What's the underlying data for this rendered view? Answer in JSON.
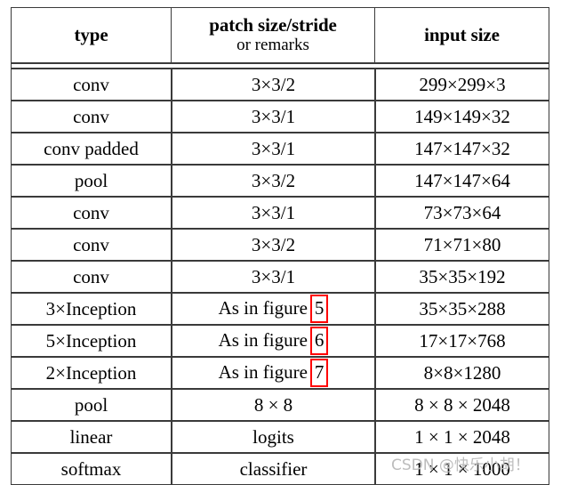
{
  "table": {
    "header": {
      "type": "type",
      "patch_main": "patch size/stride",
      "patch_sub": "or remarks",
      "input": "input size"
    },
    "rows": [
      {
        "type": "conv",
        "patch": "3×3/2",
        "fig": "",
        "input": "299×299×3"
      },
      {
        "type": "conv",
        "patch": "3×3/1",
        "fig": "",
        "input": "149×149×32"
      },
      {
        "type": "conv padded",
        "patch": "3×3/1",
        "fig": "",
        "input": "147×147×32"
      },
      {
        "type": "pool",
        "patch": "3×3/2",
        "fig": "",
        "input": "147×147×64"
      },
      {
        "type": "conv",
        "patch": "3×3/1",
        "fig": "",
        "input": "73×73×64"
      },
      {
        "type": "conv",
        "patch": "3×3/2",
        "fig": "",
        "input": "71×71×80"
      },
      {
        "type": "conv",
        "patch": "3×3/1",
        "fig": "",
        "input": "35×35×192"
      },
      {
        "type": "3×Inception",
        "patch": "As in figure",
        "fig": "5",
        "input": "35×35×288"
      },
      {
        "type": "5×Inception",
        "patch": "As in figure",
        "fig": "6",
        "input": "17×17×768"
      },
      {
        "type": "2×Inception",
        "patch": "As in figure",
        "fig": "7",
        "input": "8×8×1280"
      },
      {
        "type": "pool",
        "patch": "8 × 8",
        "fig": "",
        "input": "8 × 8 × 2048"
      },
      {
        "type": "linear",
        "patch": "logits",
        "fig": "",
        "input": "1 × 1 × 2048"
      },
      {
        "type": "softmax",
        "patch": "classifier",
        "fig": "",
        "input": "1 × 1 × 1000"
      }
    ]
  },
  "annotations": {
    "highlight_color": "#ff0000",
    "highlighted_figures": [
      "5",
      "6",
      "7"
    ]
  },
  "watermark": {
    "text": "CSDN @快乐小胡！",
    "color": "#bdbdbd"
  }
}
